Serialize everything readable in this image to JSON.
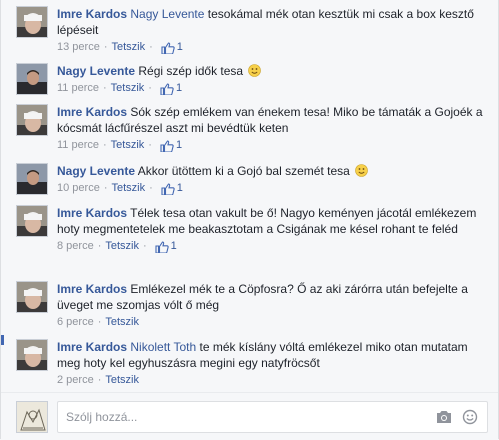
{
  "colors": {
    "link": "#365899",
    "meta": "#90949c",
    "accent": "#4267b2"
  },
  "comments": [
    {
      "author": "Imre Kardos",
      "tag": "Nagy Levente",
      "text": " tesokámal mék otan kesztük mi csak a box kesztő lépéseit",
      "time": "13 perce",
      "like_label": "Tetszik",
      "likes": "1",
      "emoji": false,
      "avatar": "bandaged-head"
    },
    {
      "author": "Nagy Levente",
      "tag": "",
      "text": " Régi szép idők tesa",
      "time": "11 perce",
      "like_label": "Tetszik",
      "likes": "1",
      "emoji": true,
      "avatar": "man-dark"
    },
    {
      "author": "Imre Kardos",
      "tag": "",
      "text": " Sók szép emlékem van énekem tesa! Miko be támaták a Gojoék a kócsmát lácfűrészel aszt mi bevédtük keten",
      "time": "11 perce",
      "like_label": "Tetszik",
      "likes": "1",
      "emoji": false,
      "avatar": "bandaged-head"
    },
    {
      "author": "Nagy Levente",
      "tag": "",
      "text": " Akkor ütöttem ki a Gojó bal szemét tesa",
      "time": "10 perce",
      "like_label": "Tetszik",
      "likes": "1",
      "emoji": true,
      "avatar": "man-dark"
    },
    {
      "author": "Imre Kardos",
      "tag": "",
      "text": " Télek tesa otan vakult be ő! Nagyo keményen jácotál emlékezem hoty megmentetelek me beakasztotam a Csigának me késel rohant te feléd",
      "time": "8 perce",
      "like_label": "Tetszik",
      "likes": "1",
      "emoji": false,
      "avatar": "bandaged-head"
    },
    {
      "author": "Imre Kardos",
      "tag": "",
      "text": " Emlékezel mék te a Cöpfosra? Ő az aki zárórra után befejelte a üveget me szomjas vólt ő még",
      "time": "6 perce",
      "like_label": "Tetszik",
      "likes": "",
      "emoji": false,
      "avatar": "bandaged-head"
    },
    {
      "author": "Imre Kardos",
      "tag": "Nikolett Toth",
      "text": " te mék kíslány vóltá emlékezel miko otan mutatam meg hoty kel egyhuszásra megini egy natyfröcsőt",
      "time": "2 perce",
      "like_label": "Tetszik",
      "likes": "",
      "emoji": false,
      "avatar": "bandaged-head"
    }
  ],
  "reply": {
    "placeholder": "Szólj hozzá..."
  }
}
